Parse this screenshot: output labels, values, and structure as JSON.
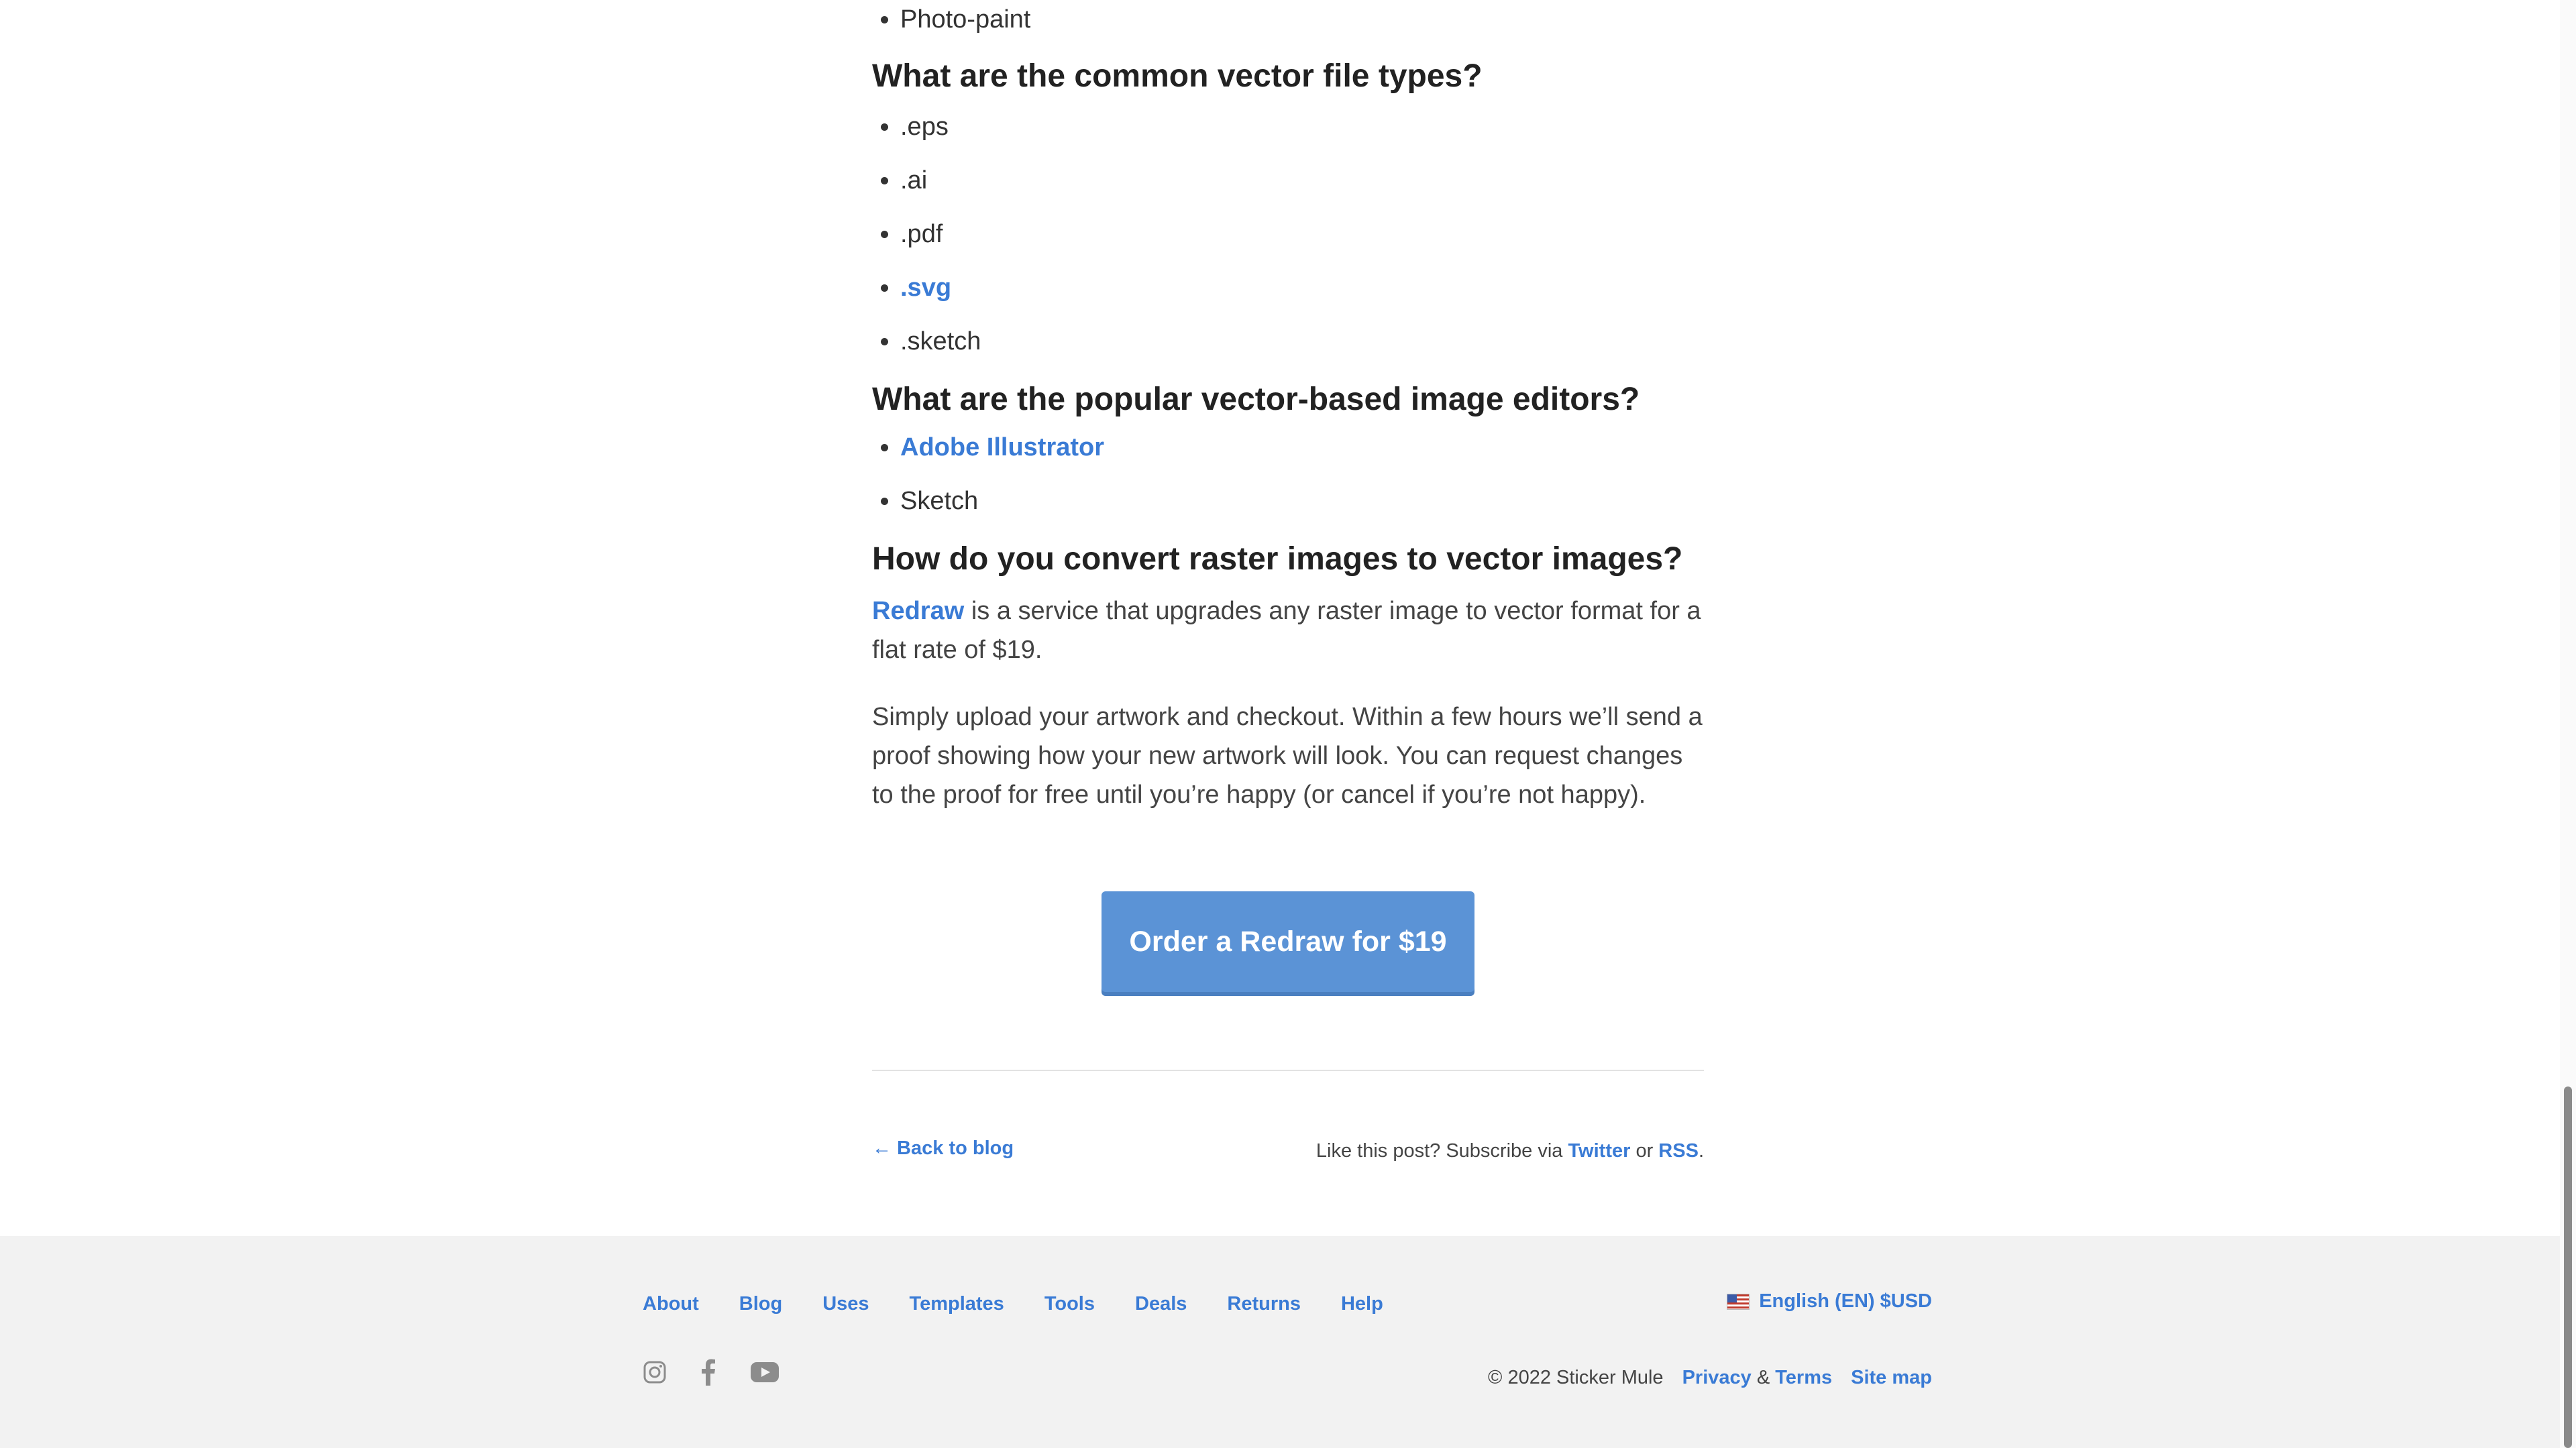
{
  "article": {
    "top_list": [
      "Photo-paint"
    ],
    "vector_types": {
      "heading": "What are the common vector file types?",
      "items": [
        {
          "label": ".eps",
          "link": false
        },
        {
          "label": ".ai",
          "link": false
        },
        {
          "label": ".pdf",
          "link": false
        },
        {
          "label": ".svg",
          "link": true
        },
        {
          "label": ".sketch",
          "link": false
        }
      ]
    },
    "editors": {
      "heading": "What are the popular vector-based image editors?",
      "items": [
        {
          "label": "Adobe Illustrator",
          "link": true
        },
        {
          "label": "Sketch",
          "link": false
        }
      ]
    },
    "convert": {
      "heading": "How do you convert raster images to vector images?",
      "p1_link": "Redraw",
      "p1_text": " is a service that upgrades any raster image to vector format for a flat rate of $19.",
      "p2_text": "Simply upload your artwork and checkout. Within a few hours we’ll send a proof showing how your new artwork will look. You can request changes to the proof for free until you’re happy (or cancel if you’re not happy)."
    },
    "cta_label": "Order a Redraw for $19"
  },
  "post_footer": {
    "back_link": "← Back to blog",
    "subscribe_prefix": "Like this post? Subscribe via ",
    "twitter": "Twitter",
    "or": " or ",
    "rss": "RSS",
    "period": "."
  },
  "footer": {
    "nav": [
      "About",
      "Blog",
      "Uses",
      "Templates",
      "Tools",
      "Deals",
      "Returns",
      "Help"
    ],
    "locale": "English (EN) $USD",
    "social_icons": [
      "instagram-icon",
      "facebook-icon",
      "youtube-icon"
    ],
    "copyright": "© 2022 Sticker Mule",
    "privacy": "Privacy",
    "amp": " & ",
    "terms": "Terms",
    "sitemap": "Site map"
  },
  "colors": {
    "link": "#3a7bd5",
    "cta": "#5b93d6",
    "footer_bg": "#f2f2f2"
  }
}
